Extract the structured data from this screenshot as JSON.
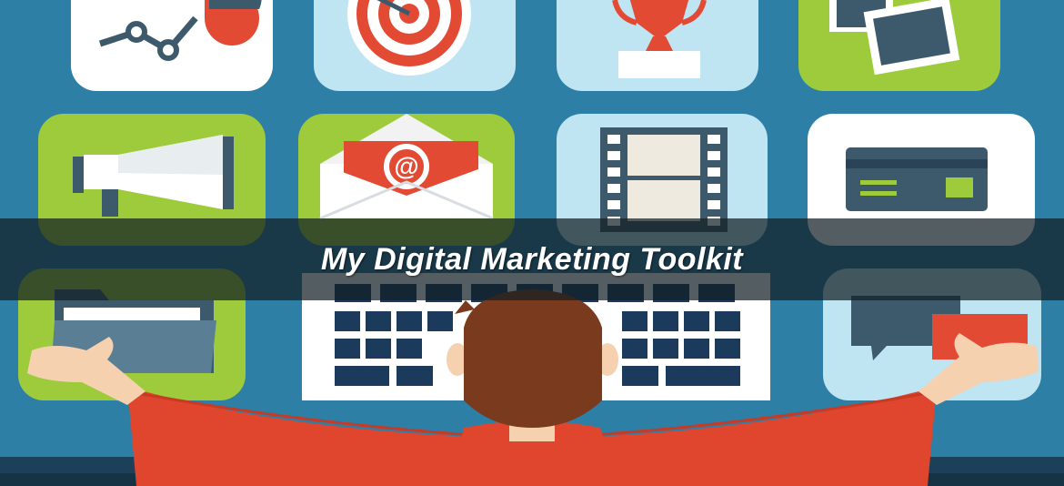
{
  "banner": {
    "title": "My Digital Marketing Toolkit"
  },
  "icons": [
    "analytics-chart-icon",
    "target-icon",
    "trophy-icon",
    "photos-icon",
    "megaphone-icon",
    "email-icon",
    "video-film-icon",
    "credit-card-icon",
    "folder-icon",
    "keyboard-icon",
    "chat-bubbles-icon"
  ],
  "colors": {
    "background": "#2e7fa6",
    "tile_white": "#ffffff",
    "tile_light_blue": "#bfe4f2",
    "tile_green": "#9ecb3c",
    "accent_red": "#e24a33",
    "dark_slate": "#3d5a6c",
    "navy": "#1b3a5c",
    "shirt_red": "#e0452d",
    "hair_brown": "#7a3a1e",
    "skin": "#f5d1b0"
  }
}
